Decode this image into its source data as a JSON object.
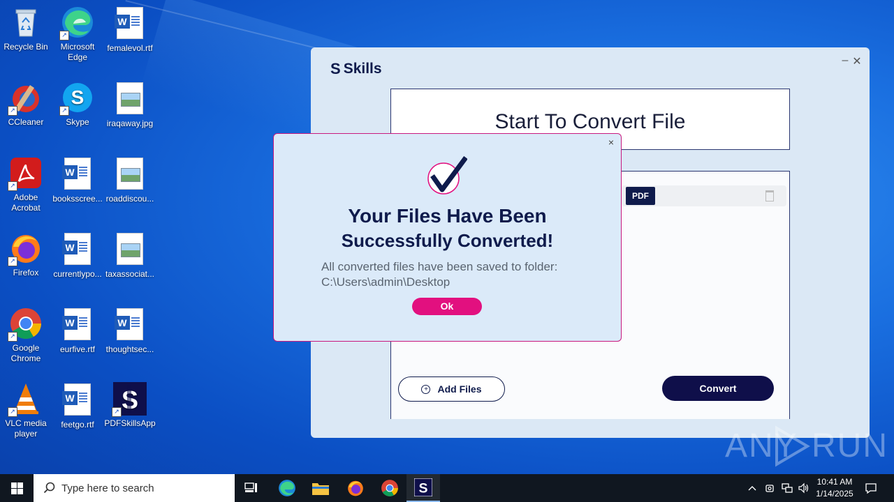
{
  "desktop": {
    "icons": [
      {
        "label": "Recycle Bin",
        "icon": "recycle-bin-icon"
      },
      {
        "label": "Microsoft Edge",
        "icon": "edge-icon"
      },
      {
        "label": "femalevol.rtf",
        "icon": "word-document-icon"
      },
      {
        "label": "CCleaner",
        "icon": "ccleaner-icon"
      },
      {
        "label": "Skype",
        "icon": "skype-icon"
      },
      {
        "label": "iraqaway.jpg",
        "icon": "image-file-icon"
      },
      {
        "label": "Adobe Acrobat",
        "icon": "acrobat-icon"
      },
      {
        "label": "booksscree...",
        "icon": "word-document-icon"
      },
      {
        "label": "roaddiscou...",
        "icon": "image-file-icon"
      },
      {
        "label": "Firefox",
        "icon": "firefox-icon"
      },
      {
        "label": "currentlypo...",
        "icon": "word-document-icon"
      },
      {
        "label": "taxassociat...",
        "icon": "image-file-icon"
      },
      {
        "label": "Google Chrome",
        "icon": "chrome-icon"
      },
      {
        "label": "eurfive.rtf",
        "icon": "word-document-icon"
      },
      {
        "label": "thoughtsec...",
        "icon": "word-document-icon"
      },
      {
        "label": "VLC media player",
        "icon": "vlc-icon"
      },
      {
        "label": "feetgo.rtf",
        "icon": "word-document-icon"
      },
      {
        "label": "PDFSkillsApp",
        "icon": "pdfskills-app-icon"
      }
    ]
  },
  "app": {
    "logo_text": "Skills",
    "logo_mark": "S",
    "minimize": "–",
    "close": "✕",
    "panel_title": "Start To Convert File",
    "file_badge": "PDF",
    "add_files_label": "Add Files",
    "add_files_glyph": "+",
    "convert_label": "Convert"
  },
  "modal": {
    "close": "×",
    "title_line1": "Your Files Have Been",
    "title_line2": "Successfully Converted!",
    "message_line1": "All converted files have been saved to folder:",
    "message_line2": "C:\\Users\\admin\\Desktop",
    "ok_label": "Ok",
    "colors": {
      "accent": "#e2107f",
      "navy": "#0f1b4c"
    }
  },
  "watermark": {
    "text_left": "ANY",
    "text_right": "RUN"
  },
  "taskbar": {
    "search_placeholder": "Type here to search",
    "time": "10:41 AM",
    "date": "1/14/2025"
  }
}
